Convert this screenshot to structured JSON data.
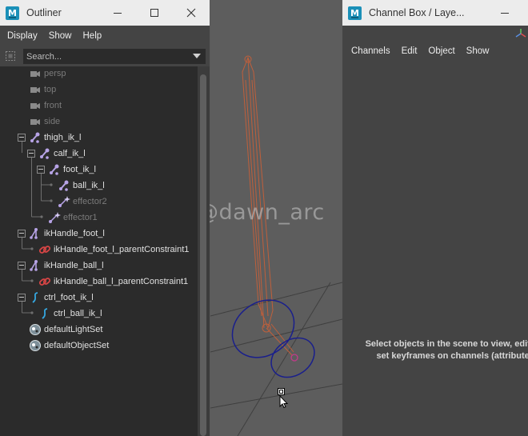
{
  "outliner": {
    "title": "Outliner",
    "menus": [
      "Display",
      "Show",
      "Help"
    ],
    "search_placeholder": "Search...",
    "items": [
      {
        "label": "persp",
        "icon": "camera-icon",
        "dim": true
      },
      {
        "label": "top",
        "icon": "camera-icon",
        "dim": true
      },
      {
        "label": "front",
        "icon": "camera-icon",
        "dim": true
      },
      {
        "label": "side",
        "icon": "camera-icon",
        "dim": true
      },
      {
        "label": "thigh_ik_l",
        "icon": "joint-icon",
        "dim": false
      },
      {
        "label": "calf_ik_l",
        "icon": "joint-icon",
        "dim": false
      },
      {
        "label": "foot_ik_l",
        "icon": "joint-icon",
        "dim": false
      },
      {
        "label": "ball_ik_l",
        "icon": "joint-icon",
        "dim": false
      },
      {
        "label": "effector2",
        "icon": "effector-icon",
        "dim": true
      },
      {
        "label": "effector1",
        "icon": "effector-icon",
        "dim": true
      },
      {
        "label": "ikHandle_foot_l",
        "icon": "ik-handle-icon",
        "dim": false
      },
      {
        "label": "ikHandle_foot_l_parentConstraint1",
        "icon": "constraint-icon",
        "dim": false
      },
      {
        "label": "ikHandle_ball_l",
        "icon": "ik-handle-icon",
        "dim": false
      },
      {
        "label": "ikHandle_ball_l_parentConstraint1",
        "icon": "constraint-icon",
        "dim": false
      },
      {
        "label": "ctrl_foot_ik_l",
        "icon": "curve-icon",
        "dim": false
      },
      {
        "label": "ctrl_ball_ik_l",
        "icon": "curve-icon",
        "dim": false
      },
      {
        "label": "defaultLightSet",
        "icon": "set-icon",
        "dim": false
      },
      {
        "label": "defaultObjectSet",
        "icon": "set-icon",
        "dim": false
      }
    ]
  },
  "channel_box": {
    "title": "Channel Box / Laye...",
    "menus": [
      "Channels",
      "Edit",
      "Object",
      "Show"
    ],
    "message": "Select objects in the scene to view, edit and set keyframes on channels (attributes)"
  },
  "viewport": {
    "watermark": "@dawn_arc"
  },
  "colors": {
    "joint": "#b7a3e6",
    "constraint": "#d64545",
    "curve": "#35a7e0",
    "bone": "#c5603a",
    "ik_circle": "#1a1f8c",
    "titlebar": "#ececec",
    "panel": "#444444",
    "tree_bg": "#2b2b2b"
  }
}
